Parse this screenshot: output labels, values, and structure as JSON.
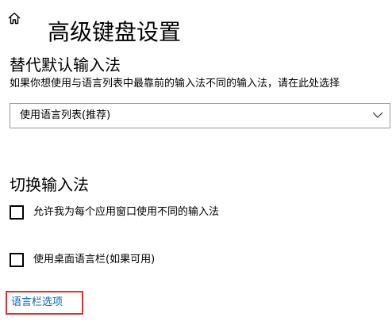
{
  "header": {
    "home_icon": "home-icon",
    "title": "高级键盘设置"
  },
  "override_section": {
    "title": "替代默认输入法",
    "description": "如果你想使用与语言列表中最靠前的输入法不同的输入法，请在此处选择",
    "select": {
      "selected_value": "使用语言列表(推荐)",
      "icon": "chevron-down-icon"
    }
  },
  "switch_section": {
    "title": "切换输入法",
    "checkboxes": [
      {
        "label": "允许我为每个应用窗口使用不同的输入法",
        "checked": false
      },
      {
        "label": "使用桌面语言栏(如果可用)",
        "checked": false
      }
    ]
  },
  "language_bar_link": {
    "label": "语言栏选项",
    "color": "#0067b8",
    "highlight_color": "#e03030"
  }
}
